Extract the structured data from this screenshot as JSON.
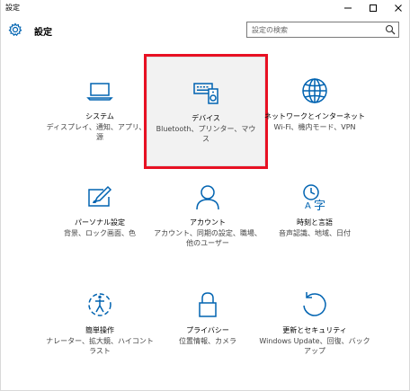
{
  "window": {
    "title": "設定",
    "header_title": "設定"
  },
  "search": {
    "placeholder": "設定の検索"
  },
  "colors": {
    "accent": "#0063b1",
    "highlight": "#e81123"
  },
  "items": [
    {
      "name": "システム",
      "desc": "ディスプレイ、通知、アプリ、電源",
      "icon": "laptop-icon"
    },
    {
      "name": "デバイス",
      "desc": "Bluetooth、プリンター、マウス",
      "icon": "devices-icon"
    },
    {
      "name": "ネットワークとインターネット",
      "desc": "Wi-Fi、機内モード、VPN",
      "icon": "globe-icon"
    },
    {
      "name": "パーソナル設定",
      "desc": "背景、ロック画面、色",
      "icon": "personalization-icon"
    },
    {
      "name": "アカウント",
      "desc": "アカウント、同期の設定、職場、他のユーザー",
      "icon": "person-icon"
    },
    {
      "name": "時刻と言語",
      "desc": "音声認識、地域、日付",
      "icon": "time-language-icon"
    },
    {
      "name": "簡単操作",
      "desc": "ナレーター、拡大鏡、ハイコントラスト",
      "icon": "ease-of-access-icon"
    },
    {
      "name": "プライバシー",
      "desc": "位置情報、カメラ",
      "icon": "lock-icon"
    },
    {
      "name": "更新とセキュリティ",
      "desc": "Windows Update、回復、バックアップ",
      "icon": "refresh-icon"
    }
  ]
}
